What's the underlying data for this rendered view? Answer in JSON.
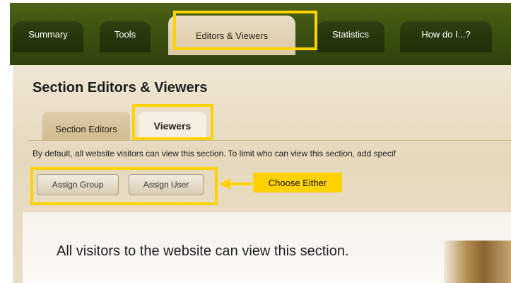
{
  "top_tabs": [
    {
      "label": "Summary"
    },
    {
      "label": "Tools"
    },
    {
      "label": "Editors & Viewers",
      "active": true
    },
    {
      "label": "Statistics"
    },
    {
      "label": "How do I...?"
    }
  ],
  "section": {
    "title": "Section Editors & Viewers",
    "subtabs": [
      {
        "label": "Section Editors"
      },
      {
        "label": "Viewers",
        "active": true
      }
    ],
    "info_text": "By default, all website visitors can view this section. To limit who can view this section, add specif",
    "buttons": {
      "assign_group": "Assign Group",
      "assign_user": "Assign User"
    },
    "callout": "Choose Either",
    "content_text": "All visitors to the website can view this section."
  },
  "colors": {
    "highlight": "#ffd200",
    "tab_bar": "#3d5311",
    "panel": "#e6d9bd"
  }
}
